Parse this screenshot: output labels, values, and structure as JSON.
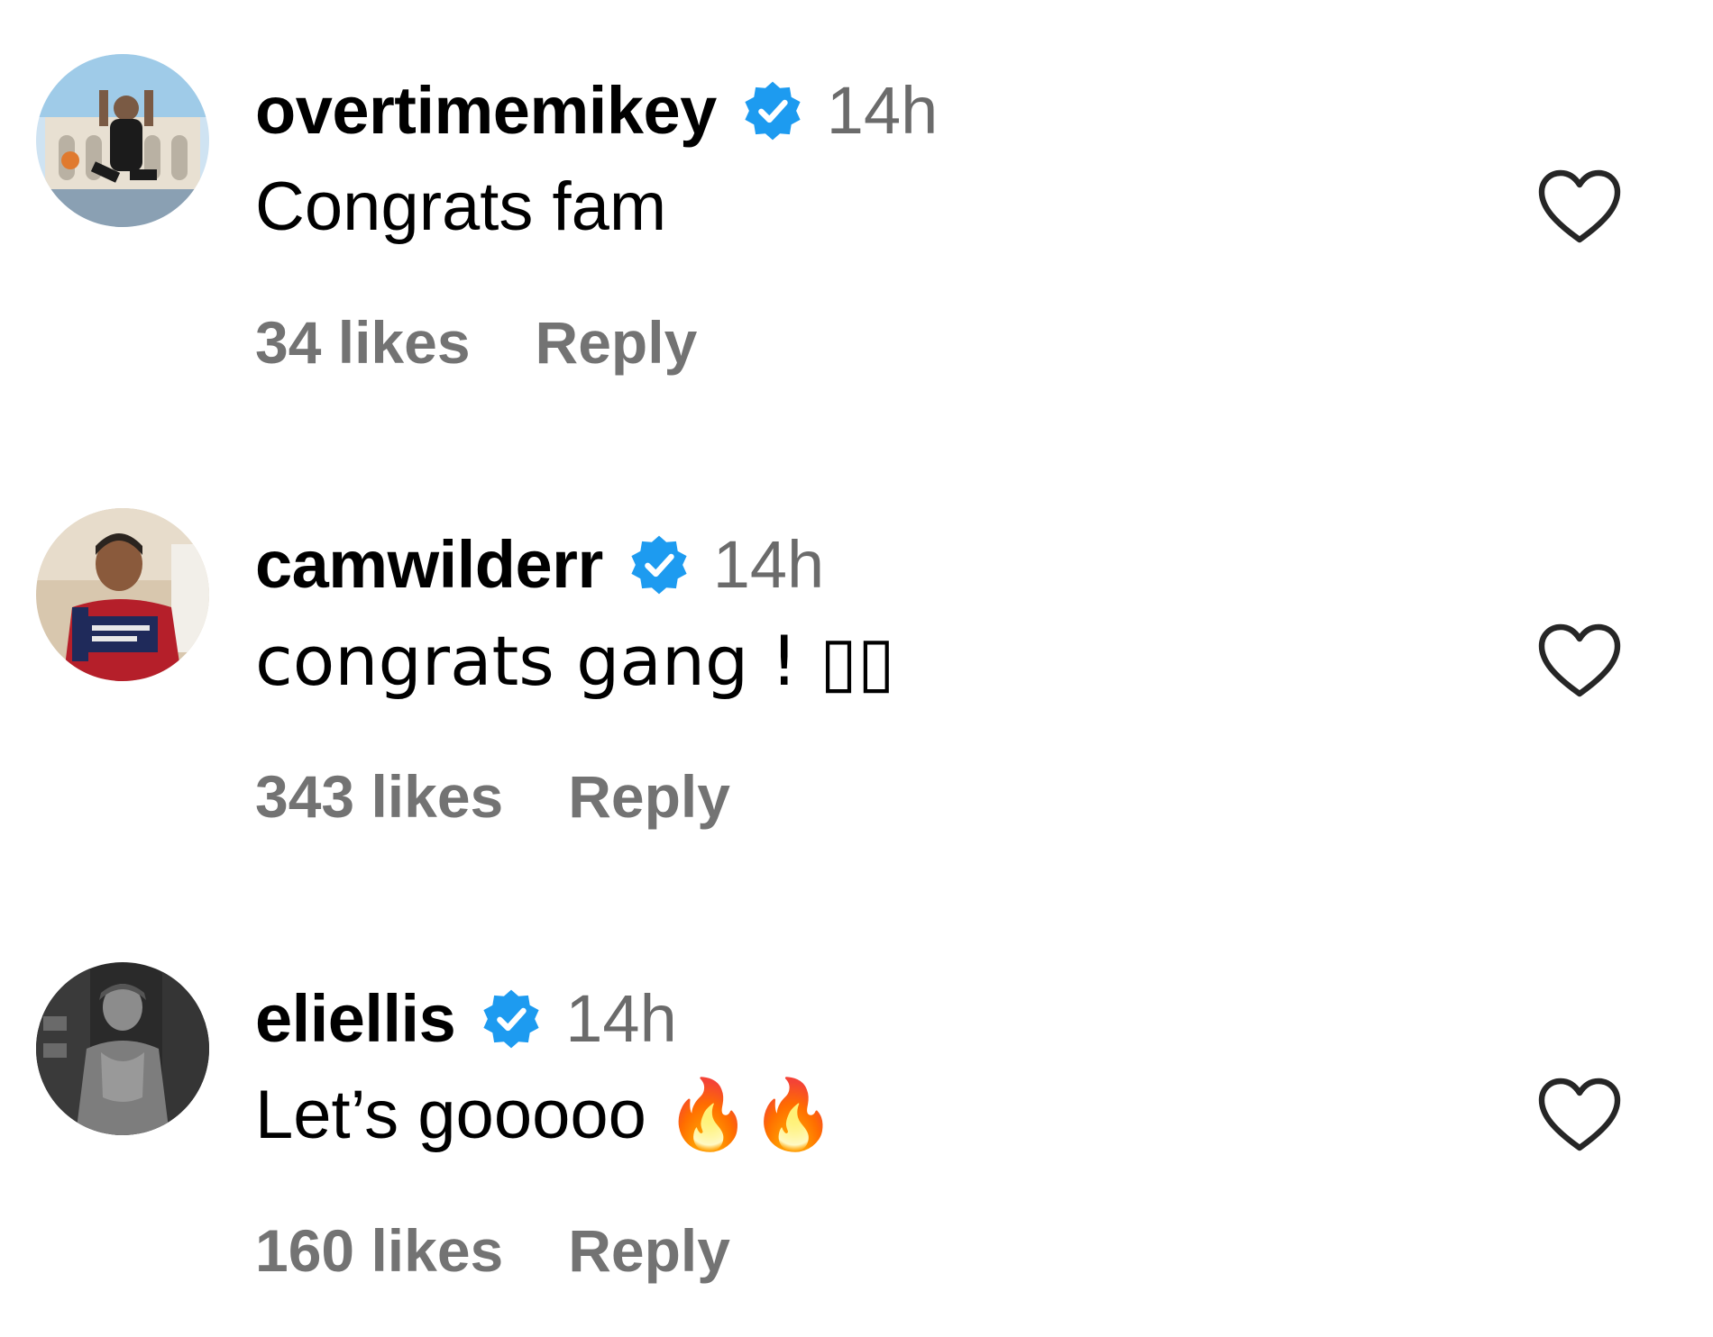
{
  "comments": [
    {
      "username": "overtimemikey",
      "verified_icon": "verified-badge-icon",
      "time": "14h",
      "text": "Congrats fam",
      "likes": "34 likes",
      "reply": "Reply",
      "like_icon": "heart-outline-icon"
    },
    {
      "username": "camwilderr",
      "verified_icon": "verified-badge-icon",
      "time": "14h",
      "text": "congrats gang ! ▯▯",
      "likes": "343 likes",
      "reply": "Reply",
      "like_icon": "heart-outline-icon"
    },
    {
      "username": "eliellis",
      "verified_icon": "verified-badge-icon",
      "time": "14h",
      "text": "Let’s gooooo 🔥🔥",
      "likes": "160 likes",
      "reply": "Reply",
      "like_icon": "heart-outline-icon"
    }
  ],
  "colors": {
    "verified": "#1d9bf0",
    "secondary_text": "#737373",
    "heart_stroke": "#262626"
  }
}
